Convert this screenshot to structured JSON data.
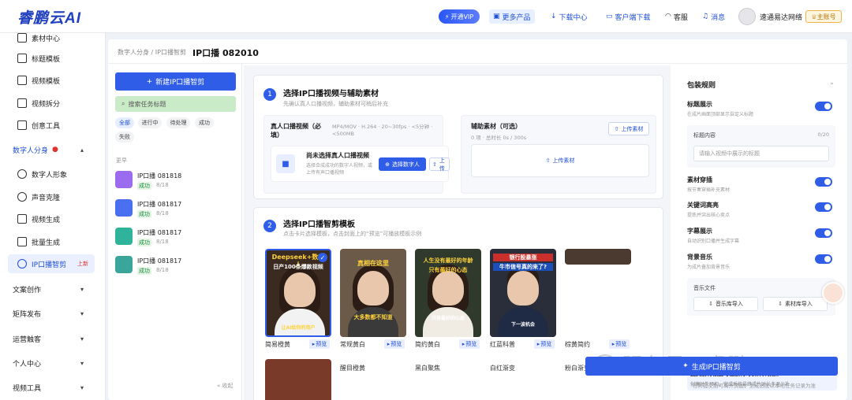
{
  "header": {
    "logo": "睿鹏云AI",
    "vip_label": "开通VIP",
    "nav": [
      "更多产品",
      "下载中心",
      "客户端下载",
      "客服",
      "消息"
    ],
    "user_name": "速通易达网络",
    "account_badge": "主账号"
  },
  "sidebar": {
    "items": [
      {
        "label": "素材中心",
        "icon": "folder-icon"
      },
      {
        "label": "标题模板",
        "icon": "list-icon"
      },
      {
        "label": "视频模板",
        "icon": "grid-icon"
      },
      {
        "label": "视频拆分",
        "icon": "split-icon"
      },
      {
        "label": "创意工具",
        "icon": "tool-icon"
      }
    ],
    "digital_group": "数字人分身",
    "digital_items": [
      {
        "label": "数字人形象",
        "icon": "person-icon"
      },
      {
        "label": "声音克隆",
        "icon": "mic-icon"
      },
      {
        "label": "视频生成",
        "icon": "video-icon"
      },
      {
        "label": "批量生成",
        "icon": "batch-icon"
      },
      {
        "label": "IP口播智剪",
        "icon": "ip-icon"
      }
    ],
    "new_tag": "上新",
    "groups": [
      "文案创作",
      "矩阵发布",
      "运营触客",
      "个人中心",
      "视频工具"
    ]
  },
  "breadcrumb": "数字人分身 / IP口播智剪",
  "page_title": "IP口播 082010",
  "tasks": {
    "new_button": "新建IP口播智剪",
    "search_placeholder": "搜索任务标题",
    "filters": [
      "全部",
      "进行中",
      "待处理",
      "成功",
      "失败"
    ],
    "section_label": "更早",
    "items": [
      {
        "name": "IP口播 081818",
        "status": "成功",
        "date": "8/18",
        "color": "#9b6cf0"
      },
      {
        "name": "IP口播 081817",
        "status": "成功",
        "date": "8/18",
        "color": "#4a6ff0"
      },
      {
        "name": "IP口播 081817",
        "status": "成功",
        "date": "8/18",
        "color": "#2fb39a"
      },
      {
        "name": "IP口播 081817",
        "status": "成功",
        "date": "8/18",
        "color": "#3aa69b"
      }
    ],
    "collapse": "收起"
  },
  "step1": {
    "num": "1",
    "title": "选择IP口播视频与辅助素材",
    "subtitle": "先确认真人口播视频，辅助素材可稍后补充",
    "real_label": "真人口播视频（必填）",
    "real_spec": "MP4/MOV · H.264 · 20~30fps · <5分钟 · <500MB",
    "empty_title": "尚未选择真人口播视频",
    "empty_desc": "选择合成成功的数字人视频，或上传有声口播视频",
    "select_btn": "选择数字人",
    "upload_short": "上传",
    "aux_label": "辅助素材（可选）",
    "aux_count": "0 项 · 总时长 0s / 300s",
    "aux_upload": "上传素材",
    "aux_upload_center": "上传素材"
  },
  "step2": {
    "num": "2",
    "title": "选择IP口播智剪模板",
    "subtitle": "点击卡片选择模板，点击封面上的“预览”可播放模板示例",
    "preview": "预览",
    "templates": [
      {
        "name": "简易橙黄",
        "cap_top": "Deepseek+数字人",
        "cap_mid": "日产100条爆款视频",
        "cap_bot": "让AI给你的用户",
        "bg": "#3b2a1f",
        "cap_color": "#ffd23a",
        "body": "#f2f2f2"
      },
      {
        "name": "常规黄白",
        "cap_top": "真相在这里",
        "cap_mid": "",
        "cap_bot": "大多数都不知道",
        "bg": "#6b5a48",
        "cap_color": "#ffd23a",
        "body": "#3a3a3a"
      },
      {
        "name": "简约黄白",
        "cap_top": "人生没有最好的年龄",
        "cap_mid": "只有最好的心态",
        "cap_bot": "只有最好的心态",
        "bg": "#2f3a2c",
        "cap_color": "#ffd23a",
        "body": "#f0ece4"
      },
      {
        "name": "红蓝科普",
        "cap_top": "银行股暴涨",
        "cap_mid": "牛市信号真的来了?",
        "cap_bot": "下一波机会",
        "bg": "#2a2d3a",
        "cap_color": "#ffffff",
        "body": "#1f2a44"
      },
      {
        "name": "棕黄简约",
        "cap_top": "",
        "cap_mid": "",
        "cap_bot": "",
        "bg": "#4a3a30",
        "cap_color": "#ffd23a",
        "body": "#333"
      }
    ],
    "row2_names": [
      "醒目橙黄",
      "黑白聚焦",
      "白红渐变",
      "粉白渐变"
    ]
  },
  "right": {
    "title": "包装规则",
    "rows": [
      {
        "label": "标题展示",
        "desc": "在成片画面顶部显示自定义标题"
      },
      {
        "label": "素材穿插",
        "desc": "按节奏穿插补充素材"
      },
      {
        "label": "关键词高亮",
        "desc": "提炼并突出核心卖点"
      },
      {
        "label": "字幕展示",
        "desc": "自动识别口播并生成字幕"
      },
      {
        "label": "背景音乐",
        "desc": "为成片叠加背景音乐"
      }
    ],
    "title_content": "标题内容",
    "title_counter": "0/20",
    "title_placeholder": "请输入视频中展示的标题",
    "music_file": "音乐文件",
    "music_lib": "音乐库导入",
    "asset_lib": "素材库导入",
    "tip_title": "提交前将根据可估素材时长计算预扣",
    "tip_desc": "创建时先预扣，完成后按最终成片时长多退少补",
    "generate": "生成IP口播智剪",
    "generate_note": "任务提交后可离开页面，生成进度以本地任务记录为准"
  },
  "watermark": "服务号 · 睿鹏云AI"
}
